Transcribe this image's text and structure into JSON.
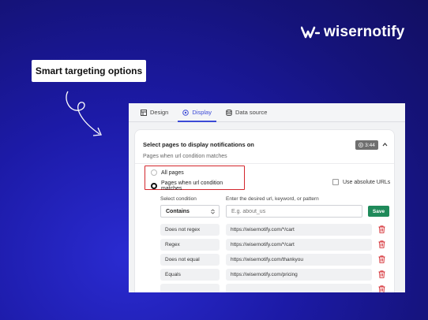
{
  "brand": {
    "name": "wisernotify",
    "logo_icon": "wiser-w-icon"
  },
  "callout": {
    "text": "Smart targeting options"
  },
  "tabs": [
    {
      "label": "Design",
      "icon": "design-icon",
      "active": false
    },
    {
      "label": "Display",
      "icon": "display-icon",
      "active": true
    },
    {
      "label": "Data source",
      "icon": "database-icon",
      "active": false
    }
  ],
  "section": {
    "title": "Select pages to display notifications on",
    "subtitle": "Pages when url condition matches",
    "video_duration": "3:44"
  },
  "options": {
    "all_pages": "All pages",
    "url_match": "Pages when url condition matches",
    "selected": "url_match",
    "absolute_urls": "Use absolute URLs"
  },
  "form": {
    "condition_label": "Select condition",
    "pattern_label": "Enter the desired url, keyword, or pattern",
    "condition_value": "Contains",
    "url_placeholder": "E.g. about_us",
    "save_label": "Save"
  },
  "rules": [
    {
      "condition": "Does not regex",
      "value": "https://wisernotify.com/*/cart"
    },
    {
      "condition": "Regex",
      "value": "https://wisernotify.com/*/cart"
    },
    {
      "condition": "Does not equal",
      "value": "https://wisernotify.com/thankyou"
    },
    {
      "condition": "Equals",
      "value": "https://wisernotify.com/pricing"
    }
  ],
  "colors": {
    "accent": "#3b4ad6",
    "save": "#1f8a5a",
    "highlight": "#d3262c",
    "delete": "#d3262c"
  }
}
